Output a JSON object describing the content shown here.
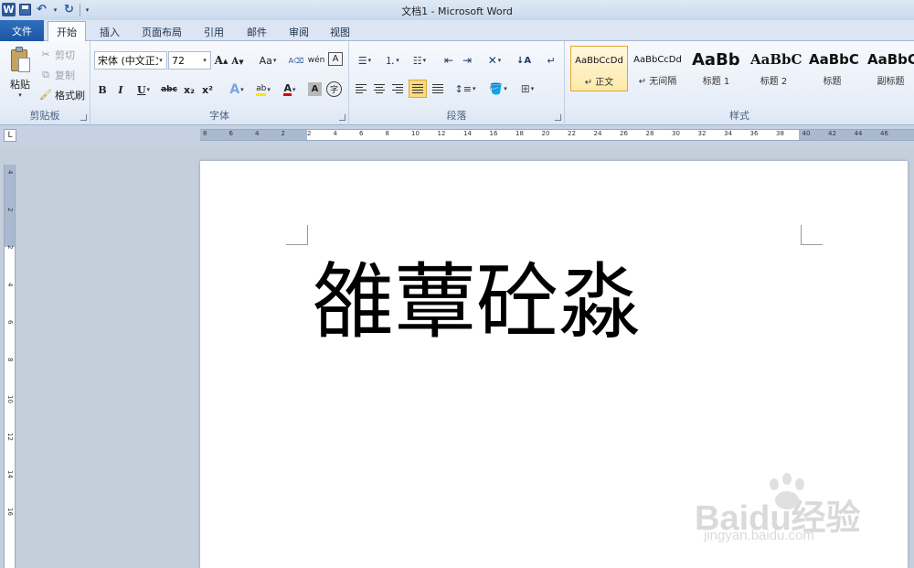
{
  "window": {
    "title": "文档1 - Microsoft Word"
  },
  "qat": {
    "app_icon": "W"
  },
  "tabs": [
    {
      "label": "文件"
    },
    {
      "label": "开始"
    },
    {
      "label": "插入"
    },
    {
      "label": "页面布局"
    },
    {
      "label": "引用"
    },
    {
      "label": "邮件"
    },
    {
      "label": "审阅"
    },
    {
      "label": "视图"
    }
  ],
  "ribbon": {
    "clipboard": {
      "label": "剪贴板",
      "paste": "粘贴",
      "cut": "剪切",
      "copy": "复制",
      "format_painter": "格式刷"
    },
    "font": {
      "label": "字体",
      "font_name": "宋体 (中文正文",
      "font_size": "72",
      "grow": "A",
      "shrink": "A",
      "change_case": "Aa",
      "bold": "B",
      "italic": "I",
      "underline": "U",
      "strikethrough": "abc",
      "subscript": "x₂",
      "superscript": "x²",
      "phonetic": "wén",
      "char_border": "A",
      "text_effect": "A",
      "highlight": "ab",
      "font_color": "A",
      "char_shading": "A",
      "enclose": "字"
    },
    "paragraph": {
      "label": "段落"
    },
    "styles": {
      "label": "样式",
      "items": [
        {
          "sample": "AaBbCcDd",
          "name": "↵ 正文"
        },
        {
          "sample": "AaBbCcDd",
          "name": "↵ 无间隔"
        },
        {
          "sample": "AaBb",
          "name": "标题 1"
        },
        {
          "sample": "AaBbC",
          "name": "标题 2"
        },
        {
          "sample": "AaBbC",
          "name": "标题"
        },
        {
          "sample": "AaBbC",
          "name": "副标题"
        }
      ]
    }
  },
  "ruler": {
    "tab_selector": "L",
    "h_numbers": [
      "8",
      "6",
      "4",
      "2",
      "2",
      "4",
      "6",
      "8",
      "10",
      "12",
      "14",
      "16",
      "18",
      "20",
      "22",
      "24",
      "26",
      "28",
      "30",
      "32",
      "34",
      "36",
      "38",
      "40",
      "42",
      "44",
      "46"
    ],
    "v_numbers": [
      "4",
      "2",
      "2",
      "4",
      "6",
      "8",
      "10",
      "12",
      "14",
      "16"
    ]
  },
  "document": {
    "text": "雒蕈砼淼"
  },
  "watermark": {
    "brand": "Baidu经验",
    "url": "jingyan.baidu.com"
  },
  "colors": {
    "file_tab": "#1c55a3",
    "active_style_border": "#e3a72f",
    "highlight": "#fcd97b"
  }
}
